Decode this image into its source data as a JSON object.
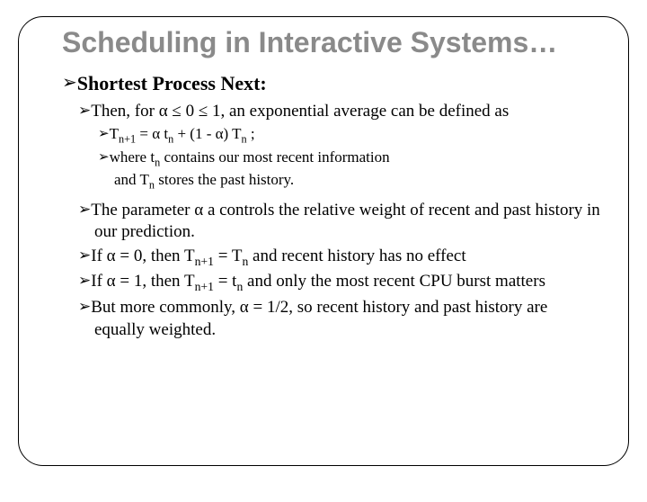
{
  "title": "Scheduling in Interactive Systems…",
  "bullet": "༼༽",
  "h1": "Shortest Process Next:",
  "p1a": "Then, for α ≤  0 ≤ 1, an exponential average can be",
  "p1b": "defined as",
  "eq_a": "T",
  "eq_a_sub": "n+1",
  "eq_b": "  =  α t",
  "eq_b_sub": "n",
  "eq_c": " + (1 -  α) T",
  "eq_c_sub": "n",
  "eq_d": "  ;",
  "w_a": "where t",
  "w_a_sub": "n",
  "w_b": " contains our most recent information",
  "w_c": "and T",
  "w_c_sub": "n",
  "w_d": " stores the past history.",
  "p2": "The parameter α a controls the relative weight of recent and past history in our prediction.",
  "p3_a": "If  α  = 0, then T",
  "p3_a_sub": "n+1",
  "p3_b": "  = T",
  "p3_b_sub": "n",
  "p3_c": " and recent history has no effect",
  "p4_a": "If  α  = 1, then T",
  "p4_a_sub": "n+1",
  "p4_b": "  = t",
  "p4_b_sub": "n",
  "p4_c": " and only the most recent CPU burst matters",
  "p5": "But more commonly, α  = 1/2, so recent history and past history are equally weighted."
}
